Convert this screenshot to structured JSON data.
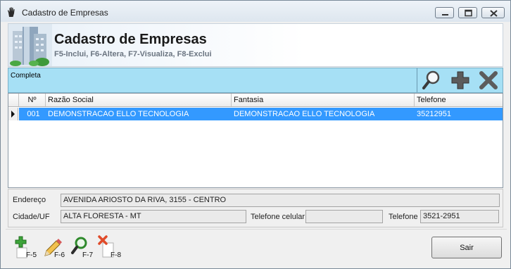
{
  "window": {
    "title": "Cadastro de Empresas",
    "icon": "hand-icon"
  },
  "header": {
    "title": "Cadastro de Empresas",
    "subtitle": "F5-Inclui, F6-Altera, F7-Visualiza, F8-Exclui",
    "icon": "building-icon"
  },
  "filter": {
    "label": "Completa",
    "tools": [
      "search-icon",
      "add-icon",
      "delete-icon"
    ]
  },
  "grid": {
    "columns": [
      "Nº",
      "Razão Social",
      "Fantasia",
      "Telefone"
    ],
    "rows": [
      [
        "001",
        "DEMONSTRACAO ELLO TECNOLOGIA",
        "DEMONSTRACAO ELLO TECNOLOGIA",
        "35212951"
      ]
    ]
  },
  "details": {
    "endereco_label": "Endereço",
    "endereco_value": "AVENIDA ARIOSTO DA RIVA, 3155 - CENTRO",
    "cidade_label": "Cidade/UF",
    "cidade_value": "ALTA FLORESTA - MT",
    "celular_label": "Telefone celular",
    "celular_value": "",
    "telefone_label": "Telefone",
    "telefone_value": "3521-2951"
  },
  "footer": {
    "keys": [
      {
        "label": "F-5",
        "icon": "add-icon"
      },
      {
        "label": "F-6",
        "icon": "pencil-icon"
      },
      {
        "label": "F-7",
        "icon": "search-icon"
      },
      {
        "label": "F-8",
        "icon": "delete-icon"
      }
    ],
    "exit_label": "Sair"
  },
  "colors": {
    "filter_bar": "#a6e0f5",
    "selection": "#3399ff"
  }
}
